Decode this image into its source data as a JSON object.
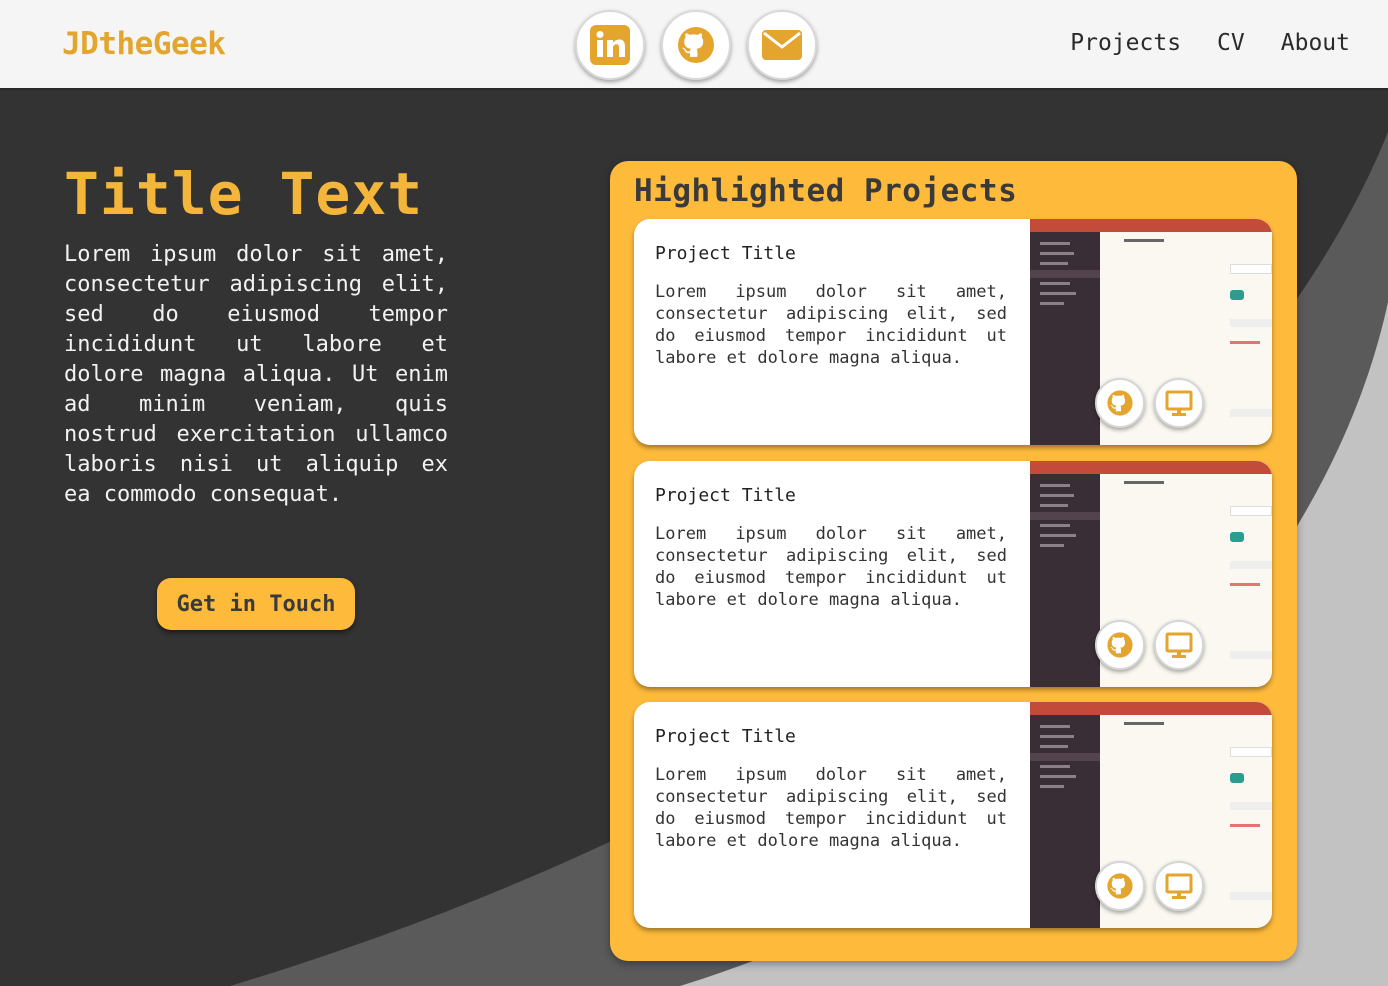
{
  "header": {
    "logo": "JDtheGeek",
    "socials": [
      {
        "icon": "linkedin-icon"
      },
      {
        "icon": "github-icon"
      },
      {
        "icon": "mail-icon"
      }
    ],
    "nav": [
      "Projects",
      "CV",
      "About"
    ]
  },
  "hero": {
    "title": "Title Text",
    "body": "Lorem ipsum dolor sit amet, consectetur adipiscing elit, sed do eiusmod tempor incididunt ut labore et dolore magna aliqua. Ut enim ad minim veniam, quis nostrud exercitation ullamco laboris nisi ut aliquip ex ea commodo consequat.",
    "cta": "Get in Touch"
  },
  "projects": {
    "heading": "Highlighted Projects",
    "items": [
      {
        "title": "Project Title",
        "description": "Lorem ipsum dolor sit amet, consectetur adipiscing elit, sed do eiusmod tempor incididunt ut labore et dolore magna aliqua."
      },
      {
        "title": "Project Title",
        "description": "Lorem ipsum dolor sit amet, consectetur adipiscing elit, sed do eiusmod tempor incididunt ut labore et dolore magna aliqua."
      },
      {
        "title": "Project Title",
        "description": "Lorem ipsum dolor sit amet, consectetur adipiscing elit, sed do eiusmod tempor incididunt ut labore et dolore magna aliqua."
      }
    ]
  },
  "colors": {
    "accent": "#fdba3b",
    "logo": "#e3a52d",
    "background": "#333333",
    "header": "#f5f5f5"
  }
}
